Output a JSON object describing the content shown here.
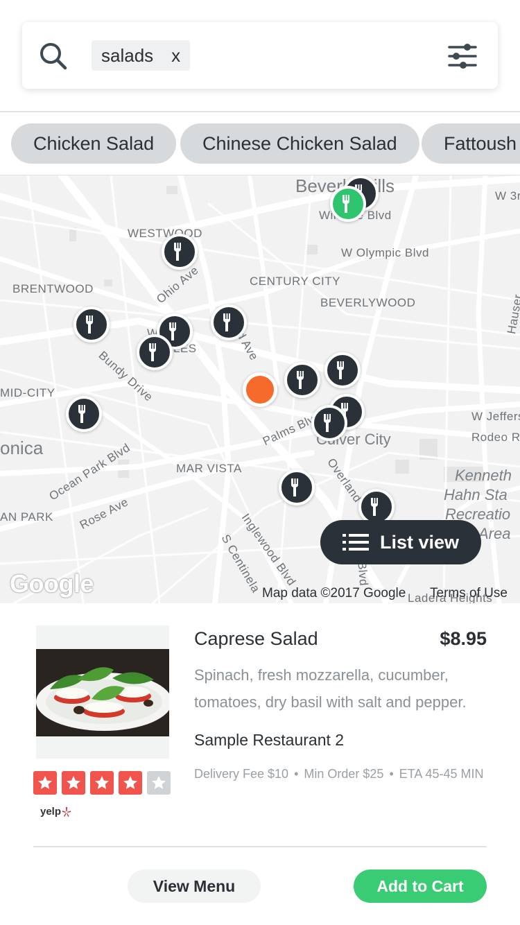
{
  "search": {
    "chip_label": "salads",
    "chip_close": "x"
  },
  "suggestions": [
    "Chicken Salad",
    "Chinese Chicken Salad",
    "Fattoush Salad"
  ],
  "map": {
    "labels": {
      "beverly_hills": "Beverly Hills",
      "wilshire_blvd": "Wilshire Blvd",
      "w_3rd": "W 3r",
      "westwood": "WESTWOOD",
      "w_olympic": "W Olympic Blvd",
      "brentwood": "BRENTWOOD",
      "century_city": "CENTURY CITY",
      "beverlywood": "BEVERLYWOOD",
      "ohio_ave": "Ohio Ave",
      "west_la_1": "W   LOS",
      "west_la_2": "LES",
      "ave": "d Ave",
      "bundy": "Bundy Drive",
      "mid_city": "MID-CITY",
      "monica": "onica",
      "palms": "Palms Blvd",
      "culver_city": "Culver City",
      "w_jefferson": "W Jeffers",
      "rodeo": "Rodeo Ro",
      "hauser": "Hauser",
      "ocean_park": "Ocean Park Blvd",
      "mar_vista": "MAR VISTA",
      "kenneth_1": "Kenneth",
      "kenneth_2": "Hahn Sta",
      "kenneth_3": "Recreatio",
      "kenneth_4": "Area",
      "overland": "Overland",
      "an_park": "AN PARK",
      "rose_ave": "Rose Ave",
      "inglewood": "Inglewood Blvd",
      "centinela": "S Centinela",
      "sep_blvd": "S  Blvd",
      "ladera": "Ladera Heights"
    },
    "list_view_label": "List view",
    "google_logo": "Google",
    "map_data": "Map data ©2017 Google",
    "terms": "Terms of Use"
  },
  "item": {
    "title": "Caprese Salad",
    "price": "$8.95",
    "description": "Spinach, fresh mozzarella, cucumber, tomatoes, dry basil with salt and pepper.",
    "restaurant": "Sample Restaurant 2",
    "delivery_fee": "Delivery Fee $10",
    "min_order": "Min Order $25",
    "eta": "ETA 45-45 MIN",
    "rating": 4,
    "rating_max": 5,
    "yelp_label": "yelp"
  },
  "actions": {
    "view_menu": "View Menu",
    "add_to_cart": "Add to Cart"
  },
  "colors": {
    "accent_green": "#39cc74",
    "pin_dark": "#2a3138",
    "user_location": "#f66b2b",
    "star_red": "#f0544c"
  }
}
